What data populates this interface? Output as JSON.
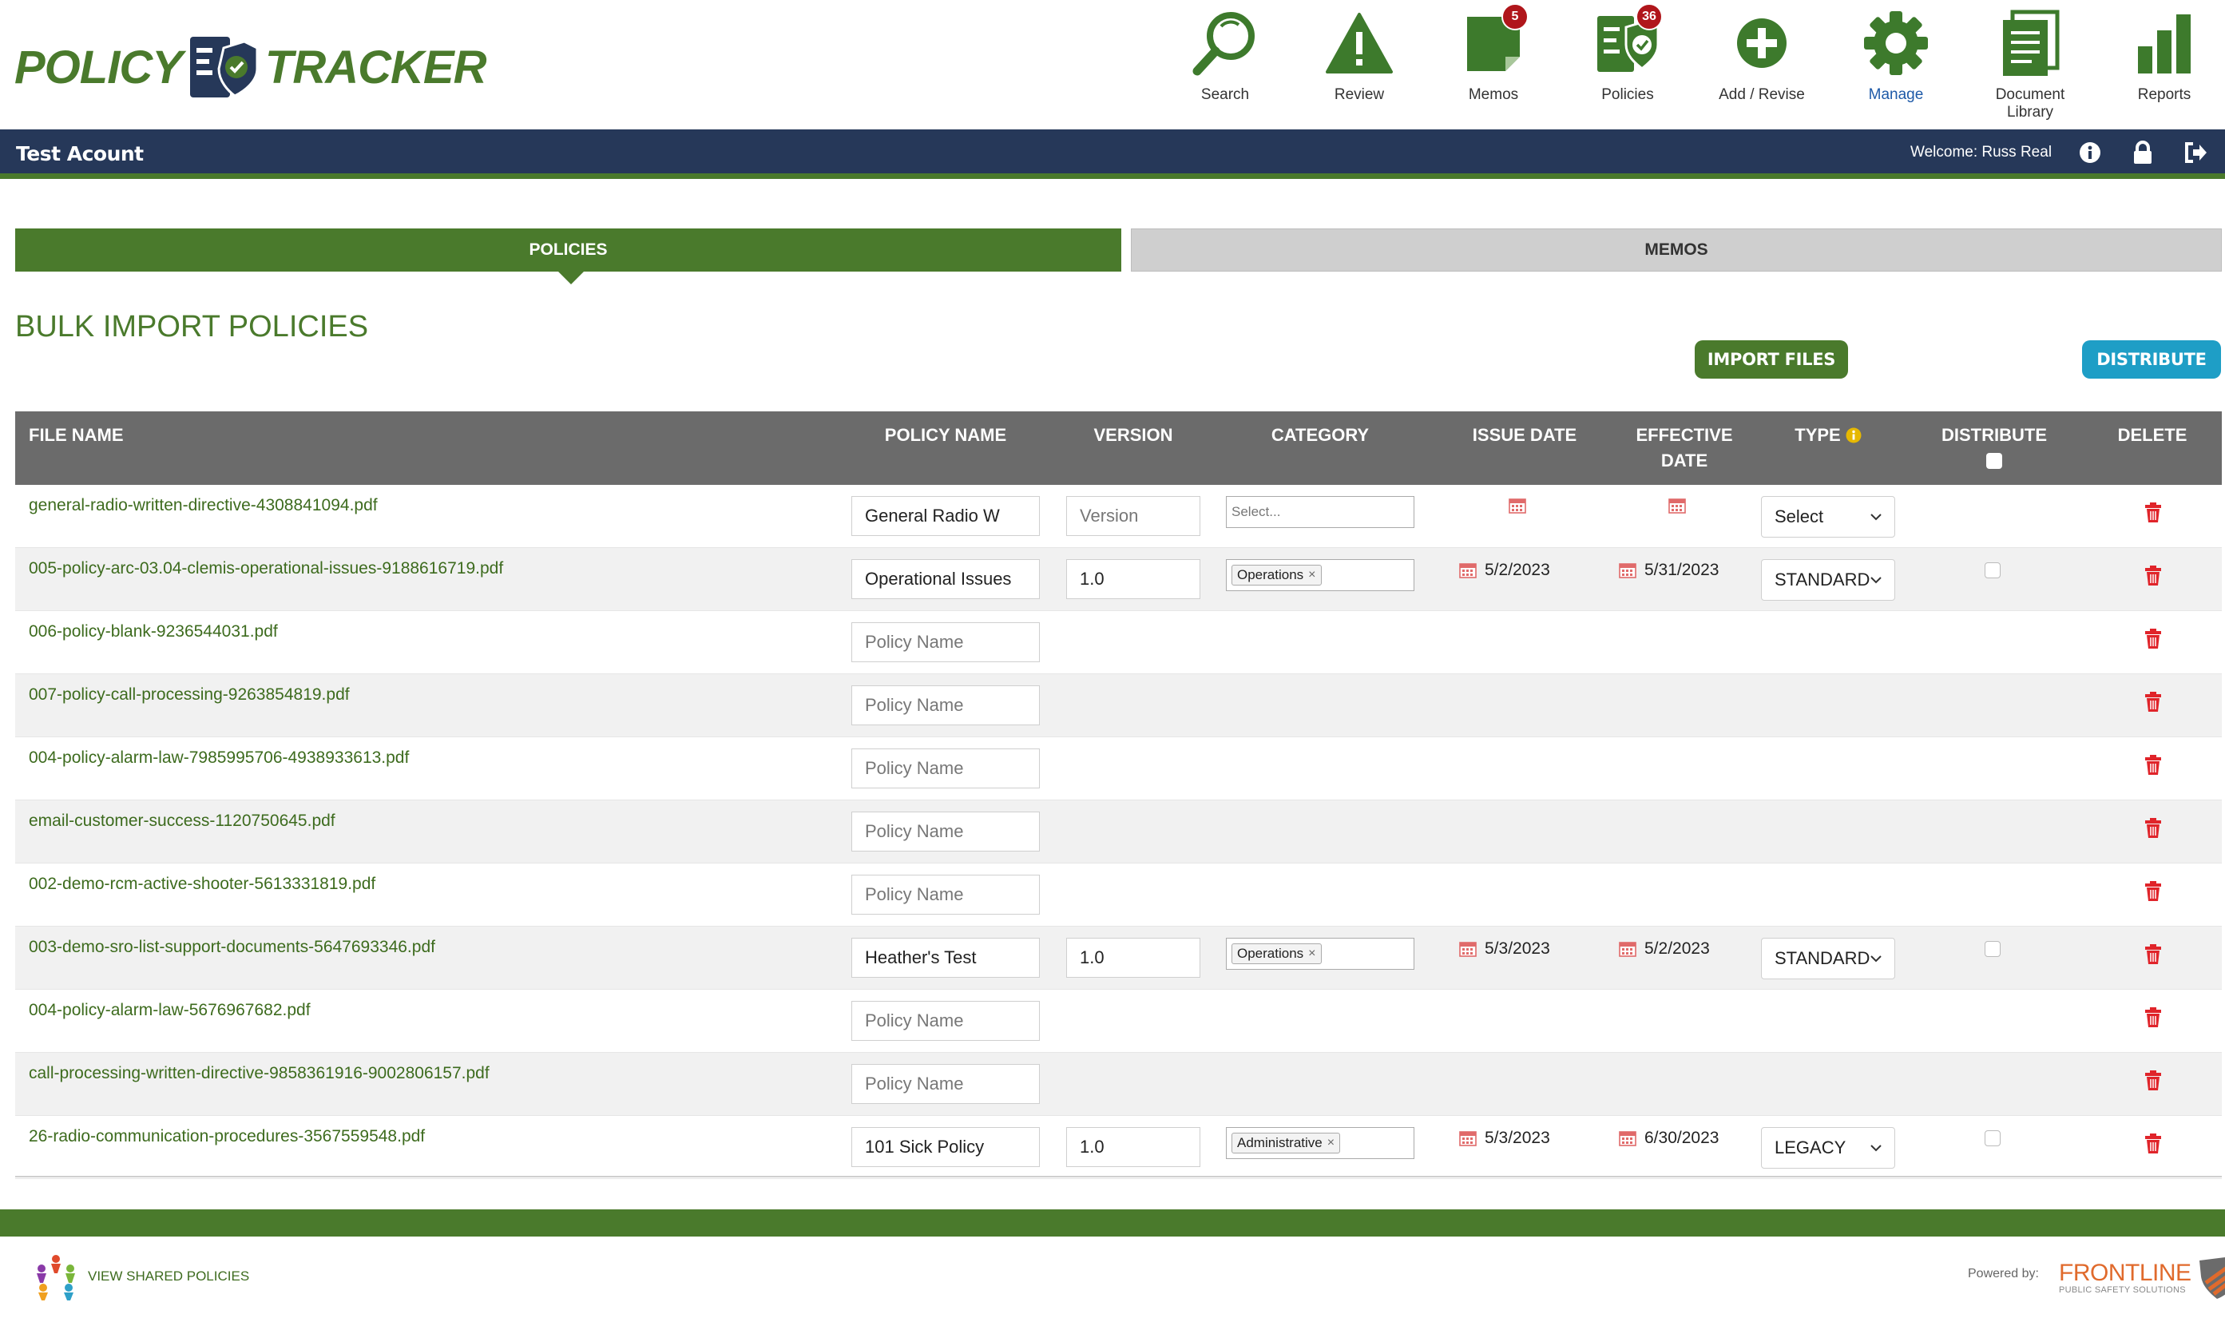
{
  "brand": {
    "left": "POLICY",
    "right": "TRACKER",
    "green": "#4a7a2c",
    "navy": "#263859"
  },
  "nav": [
    {
      "label": "Search",
      "icon": "search-icon",
      "badge": ""
    },
    {
      "label": "Review",
      "icon": "warning-icon",
      "badge": ""
    },
    {
      "label": "Memos",
      "icon": "memo-icon",
      "badge": "5"
    },
    {
      "label": "Policies",
      "icon": "policy-icon",
      "badge": "36"
    },
    {
      "label": "Add / Revise",
      "icon": "plus-circle-icon",
      "badge": ""
    },
    {
      "label": "Manage",
      "icon": "gear-icon",
      "badge": "",
      "active": true
    },
    {
      "label": "Document\nLibrary",
      "icon": "document-icon",
      "badge": ""
    },
    {
      "label": "Reports",
      "icon": "bar-chart-icon",
      "badge": ""
    }
  ],
  "account": {
    "name": "Test Acount",
    "welcome": "Welcome: Russ Real"
  },
  "tabs": {
    "policies": "POLICIES",
    "memos": "MEMOS"
  },
  "page": {
    "title": "BULK IMPORT POLICIES",
    "import_label": "IMPORT FILES",
    "distribute_label": "DISTRIBUTE"
  },
  "table": {
    "headers": {
      "file_name": "FILE NAME",
      "policy_name": "POLICY NAME",
      "version": "VERSION",
      "category": "CATEGORY",
      "issue_date": "ISSUE DATE",
      "effective_date_1": "EFFECTIVE",
      "effective_date_2": "DATE",
      "type": "TYPE",
      "distribute": "DISTRIBUTE",
      "delete": "DELETE"
    },
    "rows": [
      {
        "file": "general-radio-written-directive-4308841094.pdf",
        "policy_name": "General Radio W",
        "version_placeholder": "Version",
        "category_placeholder": "Select...",
        "issue_date": "",
        "effective_date": "",
        "type": "Select",
        "full": true,
        "blank_dates": true
      },
      {
        "file": "005-policy-arc-03.04-clemis-operational-issues-9188616719.pdf",
        "policy_name": "Operational Issues",
        "version": "1.0",
        "category": "Operations",
        "issue_date": "5/2/2023",
        "effective_date": "5/31/2023",
        "type": "STANDARD",
        "full": true
      },
      {
        "file": "006-policy-blank-9236544031.pdf",
        "policy_name_placeholder": "Policy Name"
      },
      {
        "file": "007-policy-call-processing-9263854819.pdf",
        "policy_name_placeholder": "Policy Name"
      },
      {
        "file": "004-policy-alarm-law-7985995706-4938933613.pdf",
        "policy_name_placeholder": "Policy Name"
      },
      {
        "file": "email-customer-success-1120750645.pdf",
        "policy_name_placeholder": "Policy Name"
      },
      {
        "file": "002-demo-rcm-active-shooter-5613331819.pdf",
        "policy_name_placeholder": "Policy Name"
      },
      {
        "file": "003-demo-sro-list-support-documents-5647693346.pdf",
        "policy_name": "Heather's Test",
        "version": "1.0",
        "category": "Operations",
        "issue_date": "5/3/2023",
        "effective_date": "5/2/2023",
        "type": "STANDARD",
        "full": true
      },
      {
        "file": "004-policy-alarm-law-5676967682.pdf",
        "policy_name_placeholder": "Policy Name"
      },
      {
        "file": "call-processing-written-directive-9858361916-9002806157.pdf",
        "policy_name_placeholder": "Policy Name"
      },
      {
        "file": "26-radio-communication-procedures-3567559548.pdf",
        "policy_name": "101 Sick Policy",
        "version": "1.0",
        "category": "Administrative",
        "issue_date": "5/3/2023",
        "effective_date": "6/30/2023",
        "type": "LEGACY",
        "full": true
      }
    ]
  },
  "footer": {
    "shared_label": "VIEW SHARED POLICIES",
    "powered_by": "Powered by:",
    "vendor": "FRONTLINE",
    "vendor_sub": "PUBLIC SAFETY SOLUTIONS"
  }
}
